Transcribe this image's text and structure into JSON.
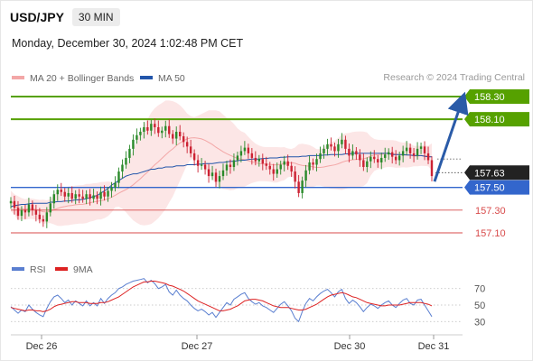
{
  "header": {
    "pair": "USD/JPY",
    "timeframe": "30 MIN"
  },
  "timestamp": "Monday, December 30, 2024 1:02:48 PM CET",
  "source": "Research © 2024 Trading Central",
  "colors": {
    "up": "#2a8a2a",
    "down": "#cc2233",
    "ma50": "#2255aa",
    "bb": "#f3a7a7",
    "resistance": "#56a100",
    "support": "#3366cc",
    "support_minor": "#d84b4b",
    "rsi": "#5a7fd0",
    "rsi_ma": "#dd2222",
    "arrow": "#2a5ba8"
  },
  "legend": {
    "bb_label": "MA 20 + Bollinger Bands",
    "ma50_label": "MA 50",
    "rsi_label": "RSI",
    "rsi_ma_label": "9MA"
  },
  "chart_data": {
    "type": "candlestick",
    "x_ticks": [
      "Dec 26",
      "Dec 27",
      "Dec 30",
      "Dec 31"
    ],
    "y_range": [
      156.95,
      158.38
    ],
    "current_price": "157.63",
    "levels": [
      {
        "label": "158.30",
        "value": 158.3,
        "type": "resistance"
      },
      {
        "label": "158.10",
        "value": 158.1,
        "type": "resistance"
      },
      {
        "label": "157.50",
        "value": 157.5,
        "type": "support"
      },
      {
        "label": "157.30",
        "value": 157.3,
        "type": "support_minor"
      },
      {
        "label": "157.10",
        "value": 157.1,
        "type": "support_minor"
      }
    ],
    "projection": {
      "from": 157.6,
      "to": 158.3
    },
    "closes": [
      157.38,
      157.32,
      157.25,
      157.3,
      157.28,
      157.35,
      157.3,
      157.26,
      157.22,
      157.2,
      157.28,
      157.36,
      157.44,
      157.48,
      157.46,
      157.42,
      157.45,
      157.4,
      157.44,
      157.42,
      157.4,
      157.44,
      157.4,
      157.43,
      157.4,
      157.46,
      157.42,
      157.47,
      157.5,
      157.54,
      157.64,
      157.7,
      157.76,
      157.84,
      157.92,
      157.96,
      157.99,
      158.03,
      158.0,
      158.06,
      158.03,
      157.98,
      158.0,
      158.04,
      157.97,
      157.93,
      157.99,
      157.95,
      157.9,
      157.86,
      157.8,
      157.74,
      157.69,
      157.7,
      157.66,
      157.6,
      157.63,
      157.55,
      157.6,
      157.65,
      157.7,
      157.68,
      157.74,
      157.78,
      157.82,
      157.85,
      157.8,
      157.76,
      157.73,
      157.75,
      157.71,
      157.69,
      157.66,
      157.62,
      157.66,
      157.7,
      157.73,
      157.69,
      157.64,
      157.55,
      157.45,
      157.56,
      157.65,
      157.72,
      157.7,
      157.75,
      157.8,
      157.84,
      157.88,
      157.86,
      157.82,
      157.88,
      157.92,
      157.84,
      157.78,
      157.82,
      157.79,
      157.74,
      157.68,
      157.73,
      157.77,
      157.75,
      157.72,
      157.76,
      157.79,
      157.81,
      157.77,
      157.74,
      157.78,
      157.82,
      157.85,
      157.8,
      157.78,
      157.84,
      157.86,
      157.8,
      157.74,
      157.6
    ],
    "ma50": [
      157.33,
      157.34,
      157.345,
      157.35,
      157.35,
      157.355,
      157.36,
      157.36,
      157.36,
      157.36,
      157.36,
      157.37,
      157.37,
      157.375,
      157.375,
      157.38,
      157.38,
      157.385,
      157.39,
      157.39,
      157.395,
      157.4,
      157.41,
      157.42,
      157.43,
      157.45,
      157.47,
      157.49,
      157.52,
      157.54,
      157.56,
      157.58,
      157.6,
      157.61,
      157.62,
      157.62,
      157.63,
      157.64,
      157.65,
      157.66,
      157.66,
      157.67,
      157.67,
      157.68,
      157.68,
      157.68,
      157.69,
      157.69,
      157.69,
      157.7,
      157.7,
      157.7,
      157.705,
      157.705,
      157.71,
      157.71,
      157.71,
      157.715,
      157.72,
      157.72,
      157.725,
      157.73,
      157.73,
      157.735,
      157.74,
      157.74,
      157.745,
      157.75,
      157.75,
      157.75,
      157.755,
      157.755,
      157.76,
      157.76,
      157.76,
      157.765,
      157.765,
      157.77,
      157.77,
      157.77,
      157.77,
      157.775,
      157.775,
      157.78,
      157.78,
      157.78,
      157.78,
      157.785,
      157.785,
      157.79,
      157.79,
      157.79,
      157.79,
      157.795,
      157.795,
      157.8,
      157.8,
      157.8,
      157.8,
      157.8,
      157.8,
      157.8,
      157.8,
      157.8,
      157.8,
      157.8,
      157.79,
      157.79,
      157.79,
      157.79,
      157.785,
      157.785,
      157.78,
      157.78,
      157.78,
      157.775,
      157.77,
      157.77
    ],
    "rsi_axis": [
      70,
      50,
      30
    ],
    "rsi": [
      48,
      44,
      40,
      44,
      42,
      50,
      45,
      41,
      38,
      36,
      46,
      54,
      60,
      62,
      58,
      53,
      56,
      50,
      55,
      52,
      49,
      55,
      49,
      53,
      49,
      58,
      52,
      58,
      62,
      65,
      70,
      72,
      75,
      77,
      79,
      80,
      81,
      82,
      77,
      80,
      76,
      70,
      72,
      75,
      66,
      62,
      68,
      62,
      58,
      55,
      50,
      46,
      43,
      45,
      42,
      38,
      41,
      35,
      41,
      47,
      53,
      50,
      57,
      60,
      63,
      65,
      58,
      54,
      51,
      53,
      49,
      47,
      44,
      41,
      46,
      51,
      54,
      49,
      43,
      34,
      30,
      42,
      52,
      58,
      55,
      60,
      64,
      67,
      69,
      65,
      60,
      66,
      69,
      58,
      52,
      56,
      53,
      48,
      42,
      47,
      51,
      49,
      46,
      50,
      53,
      55,
      50,
      47,
      52,
      56,
      58,
      52,
      50,
      56,
      57,
      50,
      43,
      36
    ],
    "rsi_ma": [
      47,
      46,
      45,
      44,
      43,
      44,
      44,
      43,
      43,
      42,
      43,
      45,
      48,
      50,
      51,
      52,
      53,
      54,
      54,
      53,
      53,
      53,
      52,
      52,
      52,
      53,
      53,
      54,
      56,
      58,
      60,
      63,
      66,
      69,
      72,
      74,
      76,
      78,
      78,
      79,
      79,
      78,
      77,
      76,
      74,
      73,
      71,
      69,
      67,
      64,
      61,
      58,
      55,
      53,
      51,
      49,
      47,
      45,
      43,
      43,
      44,
      45,
      47,
      49,
      52,
      55,
      56,
      57,
      57,
      56,
      55,
      53,
      51,
      49,
      48,
      47,
      47,
      47,
      46,
      45,
      44,
      44,
      45,
      47,
      49,
      51,
      54,
      57,
      60,
      62,
      63,
      64,
      65,
      64,
      62,
      60,
      59,
      57,
      55,
      53,
      52,
      51,
      50,
      49,
      49,
      50,
      50,
      50,
      50,
      51,
      52,
      53,
      53,
      53,
      53,
      52,
      51,
      49
    ]
  }
}
